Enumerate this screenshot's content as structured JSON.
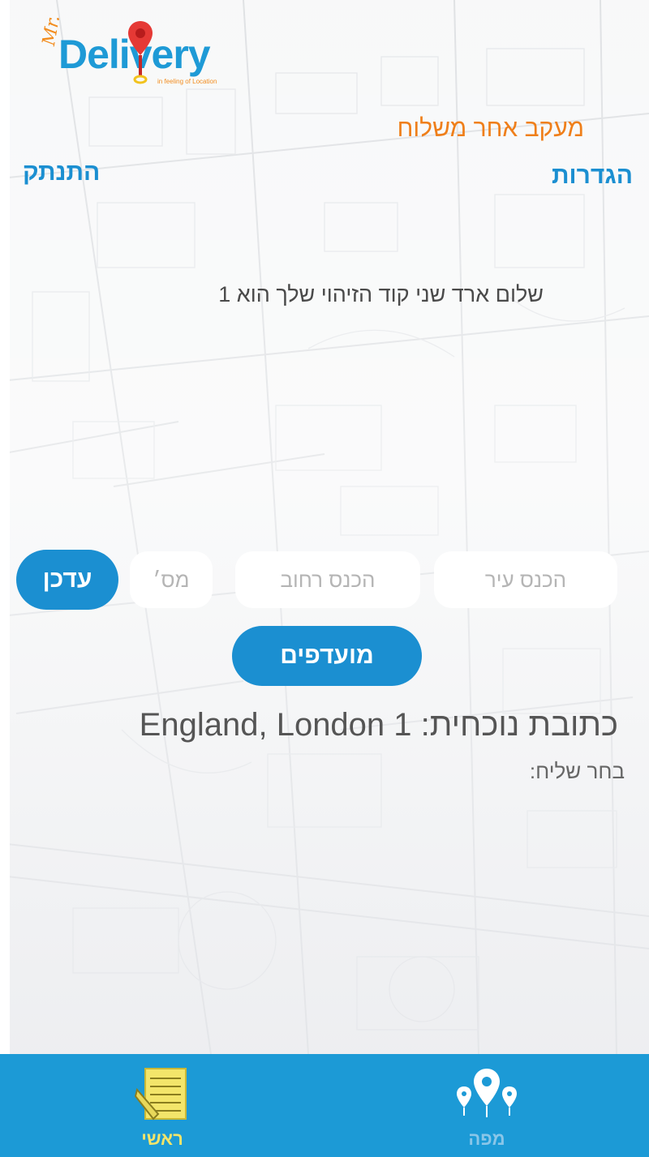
{
  "logo": {
    "mr": "Mr.",
    "name": "Delivery",
    "tagline": "in feeling of Location"
  },
  "header": {
    "title": "מעקב אחר משלוח",
    "settings": "הגדרות",
    "logout": "התנתק"
  },
  "greeting": "שלום ארד שני קוד הזיהוי שלך הוא 1",
  "form": {
    "city_placeholder": "הכנס עיר",
    "street_placeholder": "הכנס רחוב",
    "number_placeholder": "מס׳",
    "update_label": "עדכן",
    "favorites_label": "מועדפים"
  },
  "address": {
    "label": "כתובת נוכחית:",
    "value": "1 England, London"
  },
  "choose_courier": "בחר שליח:",
  "tabs": [
    {
      "label": "ראשי",
      "icon": "notepad-icon",
      "color": "#f3e56a"
    },
    {
      "label": "מפה",
      "icon": "map-pins-icon",
      "color": "#8ac6e8"
    }
  ],
  "colors": {
    "brand_blue": "#1b8fd1",
    "tabbar": "#1c9ad6",
    "accent_orange": "#ef7f1a"
  }
}
